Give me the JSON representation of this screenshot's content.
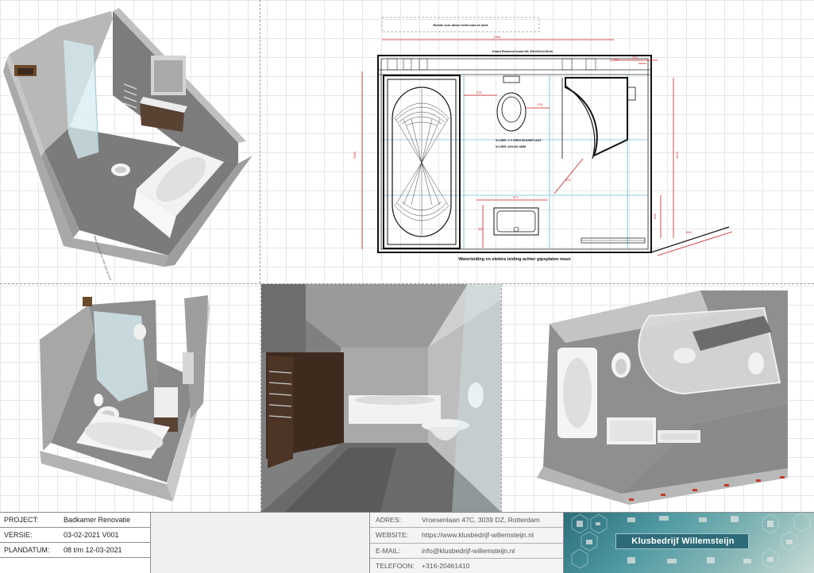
{
  "drawing": {
    "plan_labels": {
      "top_note": "Ruimte voor afvoer toilet naar de hoek",
      "board_note": "Knauf Diamond board AK 260x60x12,5mm",
      "floor_note_1": "VLOER: 4 X WEDI BOUWPLAAT",
      "floor_note_2": "VLOER: 60X120 4MM",
      "bottom_note": "Waterleiding en elektra leiding achter gipsplaten muur",
      "side_note": "Ruimte voor afvoer toilet naar de hoek"
    },
    "dimensions": {
      "top_width": "2090",
      "left_height": "2030",
      "right_height": "1610",
      "right_height_2": "600",
      "d1": "370",
      "d2": "170",
      "d3": "376",
      "d4": "178",
      "d5": "873",
      "d6": "972",
      "d7": "600",
      "d8": "1045",
      "d9": "1240",
      "d10": "849",
      "d11": "110"
    }
  },
  "title_block": {
    "project_label": "PROJECT:",
    "project_value": "Badkamer Renovatie",
    "version_label": "VERSIE:",
    "version_value": "03-02-2021 V001",
    "plandate_label": "PLANDATUM:",
    "plandate_value": "08 t/m 12-03-2021",
    "address_label": "ADRES:",
    "address_value": "Vroesenlaan 47C, 3039 DZ, Rotterdam",
    "website_label": "WEBSITE:",
    "website_value": "https://www.klusbedrijf-willemsteijn.nl",
    "email_label": "E-MAIL:",
    "email_value": "info@klusbedrijf-willemsteijn.nl",
    "phone_label": "TELEFOON:",
    "phone_value": "+316-20461410",
    "company_name": "Klusbedrijf Willemsteijn"
  },
  "colors": {
    "dimension_red": "#d21e1e",
    "logo_teal": "#2e6b78",
    "wall_gray": "#8a8a8a"
  }
}
